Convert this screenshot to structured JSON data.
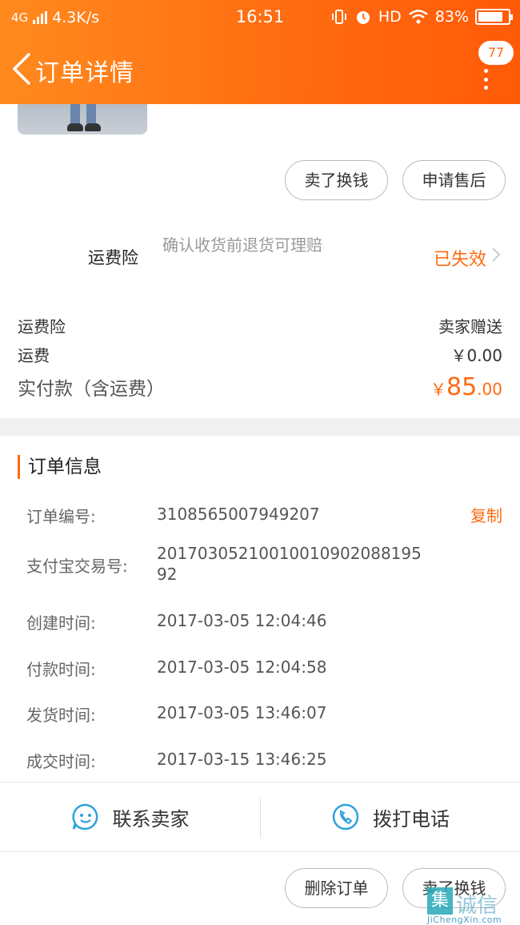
{
  "status_bar": {
    "network": "4G",
    "speed": "4.3K/s",
    "time": "16:51",
    "hd": "HD",
    "battery": "83%",
    "battery_level": 0.83
  },
  "nav": {
    "title": "订单详情",
    "badge": "77"
  },
  "product": {
    "title_peek": "—"
  },
  "top_buttons": {
    "sell": "卖了换钱",
    "after_sale": "申请售后"
  },
  "insurance": {
    "name": "运费险",
    "desc": "确认收货前退货可理赔",
    "status": "已失效"
  },
  "fees": {
    "insurance_label": "运费险",
    "insurance_value": "卖家赠送",
    "shipping_label": "运费",
    "shipping_value": "￥0.00",
    "total_label": "实付款（含运费）",
    "total_currency": "￥",
    "total_int": "85",
    "total_dec": ".00"
  },
  "order_info": {
    "title": "订单信息",
    "copy_label": "复制",
    "rows": [
      {
        "label": "订单编号:",
        "value": "3108565007949207"
      },
      {
        "label": "支付宝交易号:",
        "value": "20170305210010010902088195 92"
      },
      {
        "label": "创建时间:",
        "value": "2017-03-05 12:04:46"
      },
      {
        "label": "付款时间:",
        "value": "2017-03-05 12:04:58"
      },
      {
        "label": "发货时间:",
        "value": "2017-03-05 13:46:07"
      },
      {
        "label": "成交时间:",
        "value": "2017-03-15 13:46:25"
      }
    ]
  },
  "actions": {
    "contact": "联系卖家",
    "call": "拨打电话"
  },
  "bottom_buttons": {
    "delete": "删除订单",
    "sell": "卖了换钱"
  },
  "watermark": {
    "mark": "集",
    "text": "诚信",
    "sub": "JiChengXin.com"
  },
  "colors": {
    "accent": "#ff6a10",
    "header_start": "#ff8a1e",
    "header_end": "#ff5a08"
  }
}
